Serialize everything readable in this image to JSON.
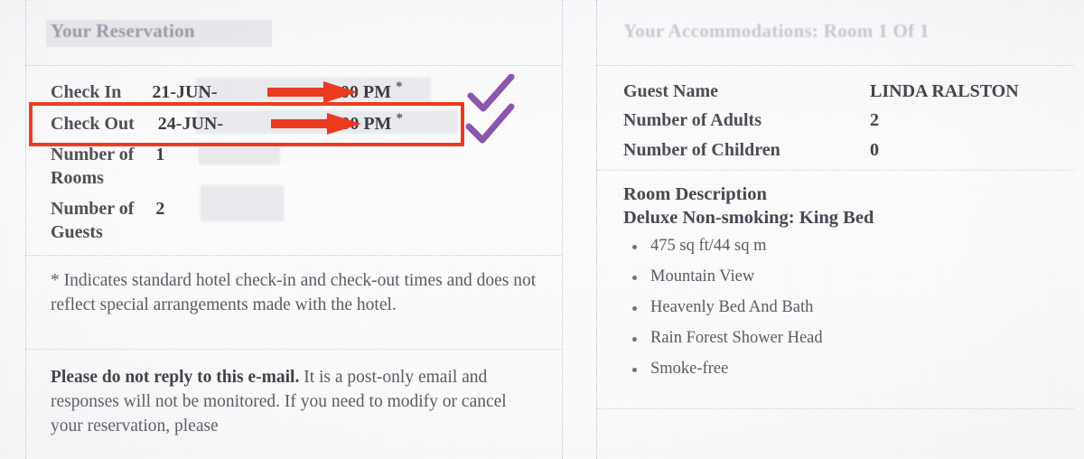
{
  "document": {
    "kind": "hotel-reservation-email-scan",
    "accent_red": "#ec3a1e",
    "accent_purple": "#7b3fa0"
  },
  "left": {
    "section_title": "Your Reservation",
    "rows": [
      {
        "label": "Check In",
        "value": "21-JUN-",
        "value_tail": "- 4:00 PM",
        "star": "*"
      },
      {
        "label": "Check Out",
        "value": "24-JUN-",
        "value_tail": "- 3:00 PM",
        "star": "*"
      }
    ],
    "rooms_label_line1": "Number of",
    "rooms_label_line2": "Rooms",
    "rooms_value": "1",
    "guests_label_line1": "Number of",
    "guests_label_line2": "Guests",
    "guests_value": "2",
    "footnote": "* Indicates standard hotel check-in and check-out times and does not reflect special arrangements made with the hotel.",
    "notice_bold": "Please do not reply to this e-mail.",
    "notice_rest": " It is a post-only email and responses will not be monitored. If you need to modify or cancel your reservation, please"
  },
  "right": {
    "section_title": "Your Accommodations: Room 1 Of 1",
    "rows": [
      {
        "label": "Guest Name",
        "value": "LINDA RALSTON"
      },
      {
        "label": "Number of Adults",
        "value": "2"
      },
      {
        "label": "Number of Children",
        "value": "0"
      }
    ],
    "room_description_label": "Room Description",
    "room_description_value": "Deluxe Non-smoking: King Bed",
    "amenities": [
      "475 sq ft/44 sq m",
      "Mountain View",
      "Heavenly Bed And Bath",
      "Rain Forest Shower Head",
      "Smoke-free"
    ]
  },
  "annotations": {
    "highlight_box_target": "Check Out row",
    "arrows": [
      {
        "target": "check-in-year",
        "color": "#ec3a1e"
      },
      {
        "target": "check-out-year",
        "color": "#ec3a1e"
      }
    ],
    "checkmarks": [
      {
        "target": "check-in-row",
        "color": "#7b3fa0"
      },
      {
        "target": "check-out-row",
        "color": "#7b3fa0"
      }
    ]
  }
}
